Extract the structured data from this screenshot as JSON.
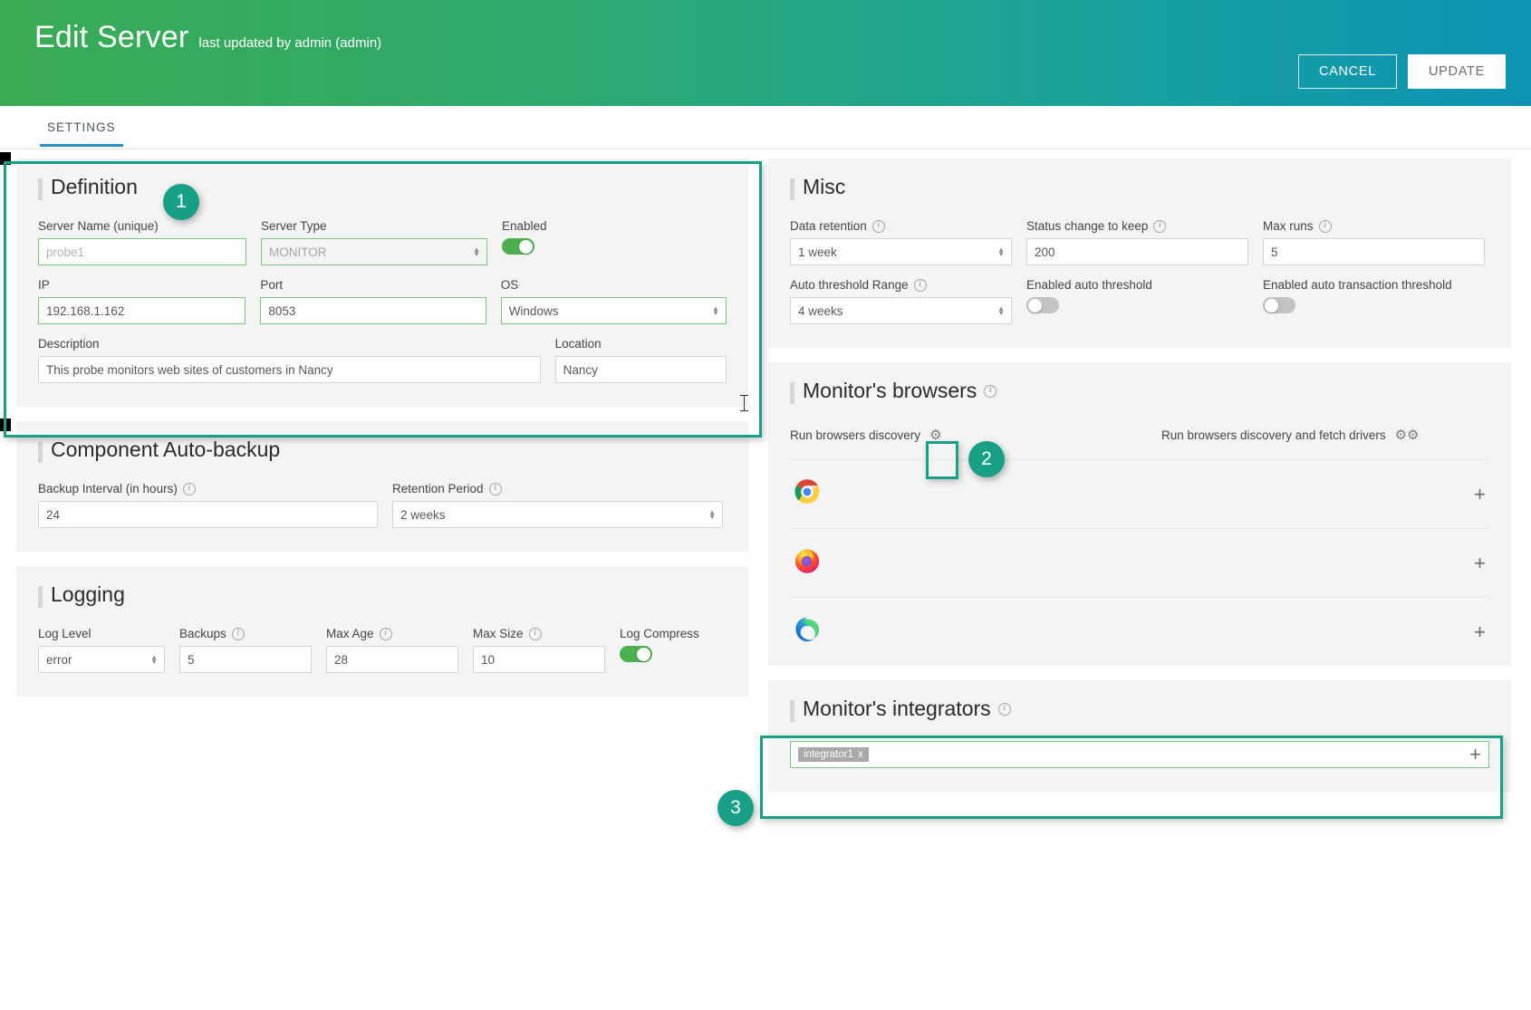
{
  "header": {
    "title": "Edit Server",
    "subtitle": "last updated by admin (admin)",
    "cancel_label": "CANCEL",
    "update_label": "UPDATE",
    "accent_start": "#3aab54",
    "accent_end": "#0d92b4"
  },
  "tabs": [
    {
      "label": "SETTINGS",
      "active": true
    }
  ],
  "definition": {
    "title": "Definition",
    "server_name": {
      "label": "Server Name (unique)",
      "value": "probe1"
    },
    "server_type": {
      "label": "Server Type",
      "value": "MONITOR"
    },
    "enabled": {
      "label": "Enabled",
      "state": "on"
    },
    "ip": {
      "label": "IP",
      "value": "192.168.1.162"
    },
    "port": {
      "label": "Port",
      "value": "8053"
    },
    "os": {
      "label": "OS",
      "value": "Windows"
    },
    "description": {
      "label": "Description",
      "value": "This probe monitors web sites of customers in Nancy"
    },
    "location": {
      "label": "Location",
      "value": "Nancy"
    }
  },
  "autobackup": {
    "title": "Component Auto-backup",
    "backup_interval": {
      "label": "Backup Interval (in hours)",
      "value": "24",
      "info": "i"
    },
    "retention_period": {
      "label": "Retention Period",
      "value": "2 weeks",
      "info": "i"
    }
  },
  "logging": {
    "title": "Logging",
    "log_level": {
      "label": "Log Level",
      "value": "error"
    },
    "backups": {
      "label": "Backups",
      "value": "5",
      "info": "i"
    },
    "max_age": {
      "label": "Max Age",
      "value": "28",
      "info": "i"
    },
    "max_size": {
      "label": "Max Size",
      "value": "10",
      "info": "i"
    },
    "log_compress": {
      "label": "Log Compress",
      "state": "on"
    }
  },
  "misc": {
    "title": "Misc",
    "data_retention": {
      "label": "Data retention",
      "value": "1 week",
      "info": "i"
    },
    "status_change_to_keep": {
      "label": "Status change to keep",
      "value": "200",
      "info": "i"
    },
    "max_runs": {
      "label": "Max runs",
      "value": "5",
      "info": "i"
    },
    "auto_threshold_range": {
      "label": "Auto threshold Range",
      "value": "4 weeks",
      "info": "i"
    },
    "enabled_auto_threshold": {
      "label": "Enabled auto threshold",
      "state": "off"
    },
    "enabled_auto_transaction_threshold": {
      "label": "Enabled auto transaction threshold",
      "state": "off"
    }
  },
  "browsers": {
    "title": "Monitor's browsers",
    "info": "i",
    "run_discovery_label": "Run browsers discovery",
    "run_discovery_fetch_label": "Run browsers discovery and fetch drivers",
    "rows": [
      {
        "icon": "chrome-icon",
        "name": "chrome",
        "add_label": "+"
      },
      {
        "icon": "firefox-icon",
        "name": "firefox",
        "add_label": "+"
      },
      {
        "icon": "edge-icon",
        "name": "edge",
        "add_label": "+"
      }
    ]
  },
  "integrators": {
    "title": "Monitor's integrators",
    "info": "i",
    "chips": [
      {
        "label": "integrator1",
        "remove_label": "x"
      }
    ],
    "add_label": "+"
  },
  "callouts": [
    {
      "number": "1",
      "target": "definition-card"
    },
    {
      "number": "2",
      "target": "run-browsers-discovery-gear"
    },
    {
      "number": "3",
      "target": "integrators-card"
    }
  ]
}
